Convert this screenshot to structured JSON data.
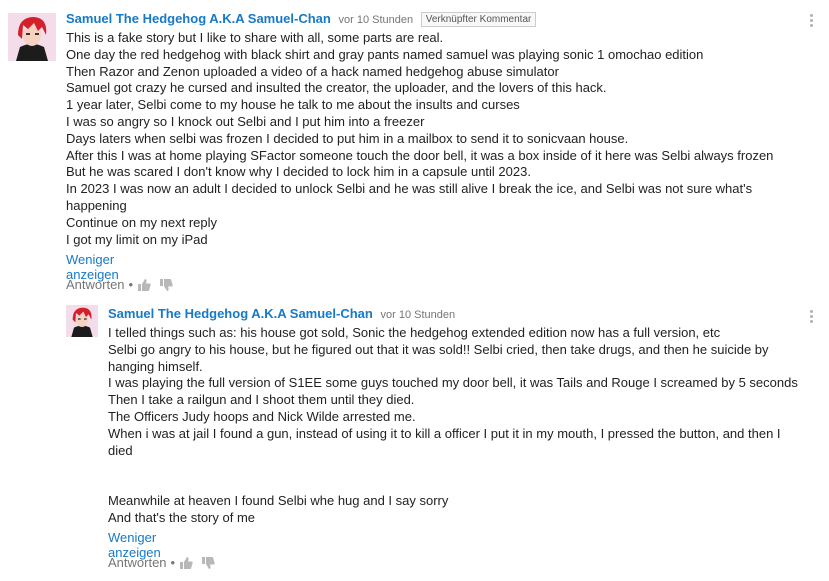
{
  "comment": {
    "author": "Samuel The Hedgehog A.K.A Samuel-Chan",
    "time": "vor 10 Stunden",
    "badge": "Verknüpfter Kommentar",
    "lines": [
      "This is a fake story but I like to share with all, some parts are real.",
      "One day the red hedgehog with black shirt and gray pants named samuel was playing sonic 1 omochao edition",
      "Then Razor and Zenon uploaded a video of a hack named hedgehog abuse simulator",
      "Samuel got crazy he cursed and insulted the creator, the uploader, and the lovers of this hack.",
      "1 year later, Selbi come to my house he talk to me about the insults and curses",
      "I was so angry so I knock out Selbi and I put him into a freezer",
      "Days laters when selbi was frozen I decided to put him in a mailbox to send it to sonicvaan house.",
      "After this I was at home playing SFactor someone touch the door bell, it was a box inside of it here was Selbi always frozen",
      "But he was scared I don't know why I decided to lock him in a capsule until 2023.",
      "In 2023 I was now an adult I decided to unlock Selbi and he was still alive I break the ice, and Selbi was not sure what's happening",
      "Continue on my next reply",
      "I got my limit on my iPad"
    ],
    "show_less": "Weniger anzeigen",
    "reply": "Antworten",
    "dot": "•"
  },
  "reply_comment": {
    "author": "Samuel The Hedgehog A.K.A Samuel-Chan",
    "time": "vor 10 Stunden",
    "lines": [
      "I telled things such as: his house got sold, Sonic the hedgehog extended edition now has a full version, etc",
      "Selbi go angry to his house, but he figured out that it was sold!! Selbi cried, then take drugs, and then he suicide by hanging himself.",
      "I was playing the full version of S1EE some guys touched my door bell, it was Tails and Rouge I screamed by 5 seconds",
      "Then I take a railgun and I shoot them until they died.",
      "The Officers Judy hoops and Nick Wilde arrested me.",
      "When i was at jail I found a gun, instead of using it to kill a officer I put it in my mouth, I pressed the button, and then I died",
      "",
      "",
      "Meanwhile at heaven I found Selbi whe hug and I say sorry",
      "And that's the story of me"
    ],
    "show_less": "Weniger anzeigen",
    "reply": "Antworten",
    "dot": "•"
  },
  "icons": {
    "like": "thumbs-up-icon",
    "dislike": "thumbs-down-icon",
    "menu": "more-vertical-icon"
  },
  "colors": {
    "author_link": "#167ac6",
    "meta_gray": "#767676",
    "text": "#222222",
    "avatar_bg": "#f3ddea",
    "avatar_hair": "#d4202a"
  }
}
